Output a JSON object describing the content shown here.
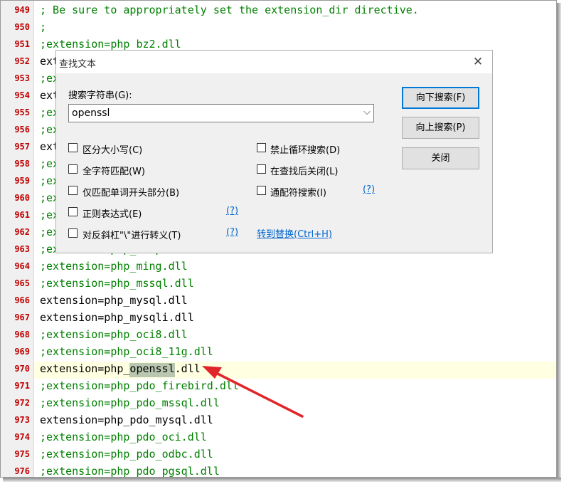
{
  "editor": {
    "lines": [
      {
        "num": "949",
        "text": "; Be sure to appropriately set the extension_dir directive.",
        "comment": true
      },
      {
        "num": "950",
        "text": ";",
        "comment": true
      },
      {
        "num": "951",
        "text": ";extension=php_bz2.dll",
        "comment": true
      },
      {
        "num": "952",
        "text": "ext",
        "comment": false
      },
      {
        "num": "953",
        "text": ";ex",
        "comment": true
      },
      {
        "num": "954",
        "text": "ext",
        "comment": false
      },
      {
        "num": "955",
        "text": ";ex",
        "comment": true
      },
      {
        "num": "956",
        "text": ";ex",
        "comment": true
      },
      {
        "num": "957",
        "text": "ext",
        "comment": false
      },
      {
        "num": "958",
        "text": ";ex",
        "comment": true
      },
      {
        "num": "959",
        "text": ";ex",
        "comment": true
      },
      {
        "num": "960",
        "text": ";ex",
        "comment": true
      },
      {
        "num": "961",
        "text": ";ex",
        "comment": true
      },
      {
        "num": "962",
        "text": ";ex",
        "comment": true
      },
      {
        "num": "963",
        "text": ";extension=php_ldap.dll",
        "comment": true
      },
      {
        "num": "964",
        "text": ";extension=php_ming.dll",
        "comment": true
      },
      {
        "num": "965",
        "text": ";extension=php_mssql.dll",
        "comment": true
      },
      {
        "num": "966",
        "text": "extension=php_mysql.dll",
        "comment": false
      },
      {
        "num": "967",
        "text": "extension=php_mysqli.dll",
        "comment": false
      },
      {
        "num": "968",
        "text": ";extension=php_oci8.dll",
        "comment": true
      },
      {
        "num": "969",
        "text": ";extension=php_oci8_11g.dll",
        "comment": true
      },
      {
        "num": "970",
        "text": "extension=php_openssl.dll",
        "comment": false
      },
      {
        "num": "971",
        "text": ";extension=php_pdo_firebird.dll",
        "comment": true
      },
      {
        "num": "972",
        "text": ";extension=php_pdo_mssql.dll",
        "comment": true
      },
      {
        "num": "973",
        "text": "extension=php_pdo_mysql.dll",
        "comment": false
      },
      {
        "num": "974",
        "text": ";extension=php_pdo_oci.dll",
        "comment": true
      },
      {
        "num": "975",
        "text": ";extension=php_pdo_odbc.dll",
        "comment": true
      },
      {
        "num": "976",
        "text": ";extension=php_pdo_pgsql.dll",
        "comment": true
      }
    ],
    "current_line": "970",
    "highlighted_match": "openssl",
    "colors": {
      "comment": "#008000",
      "line_number": "#c00000",
      "current_line_bg": "#ffffe1"
    }
  },
  "dialog": {
    "title": "查找文本",
    "close_icon": "close-icon",
    "search_label": "搜索字符串(G):",
    "search_value": "openssl",
    "buttons": {
      "find_down": "向下搜索(F)",
      "find_up": "向上搜索(P)",
      "close": "关闭"
    },
    "options_left": [
      {
        "label": "区分大小写(C)",
        "checked": false
      },
      {
        "label": "全字符匹配(W)",
        "checked": false
      },
      {
        "label": "仅匹配单词开头部分(B)",
        "checked": false
      },
      {
        "label": "正则表达式(E)",
        "checked": false
      },
      {
        "label": "对反斜杠\"\\\"进行转义(T)",
        "checked": false
      }
    ],
    "options_right": [
      {
        "label": "禁止循环搜索(D)",
        "checked": false
      },
      {
        "label": "在查找后关闭(L)",
        "checked": false
      },
      {
        "label": "通配符搜索(I)",
        "checked": false
      }
    ],
    "help_link": "(?)",
    "goto_replace": "转到替换(Ctrl+H)"
  }
}
